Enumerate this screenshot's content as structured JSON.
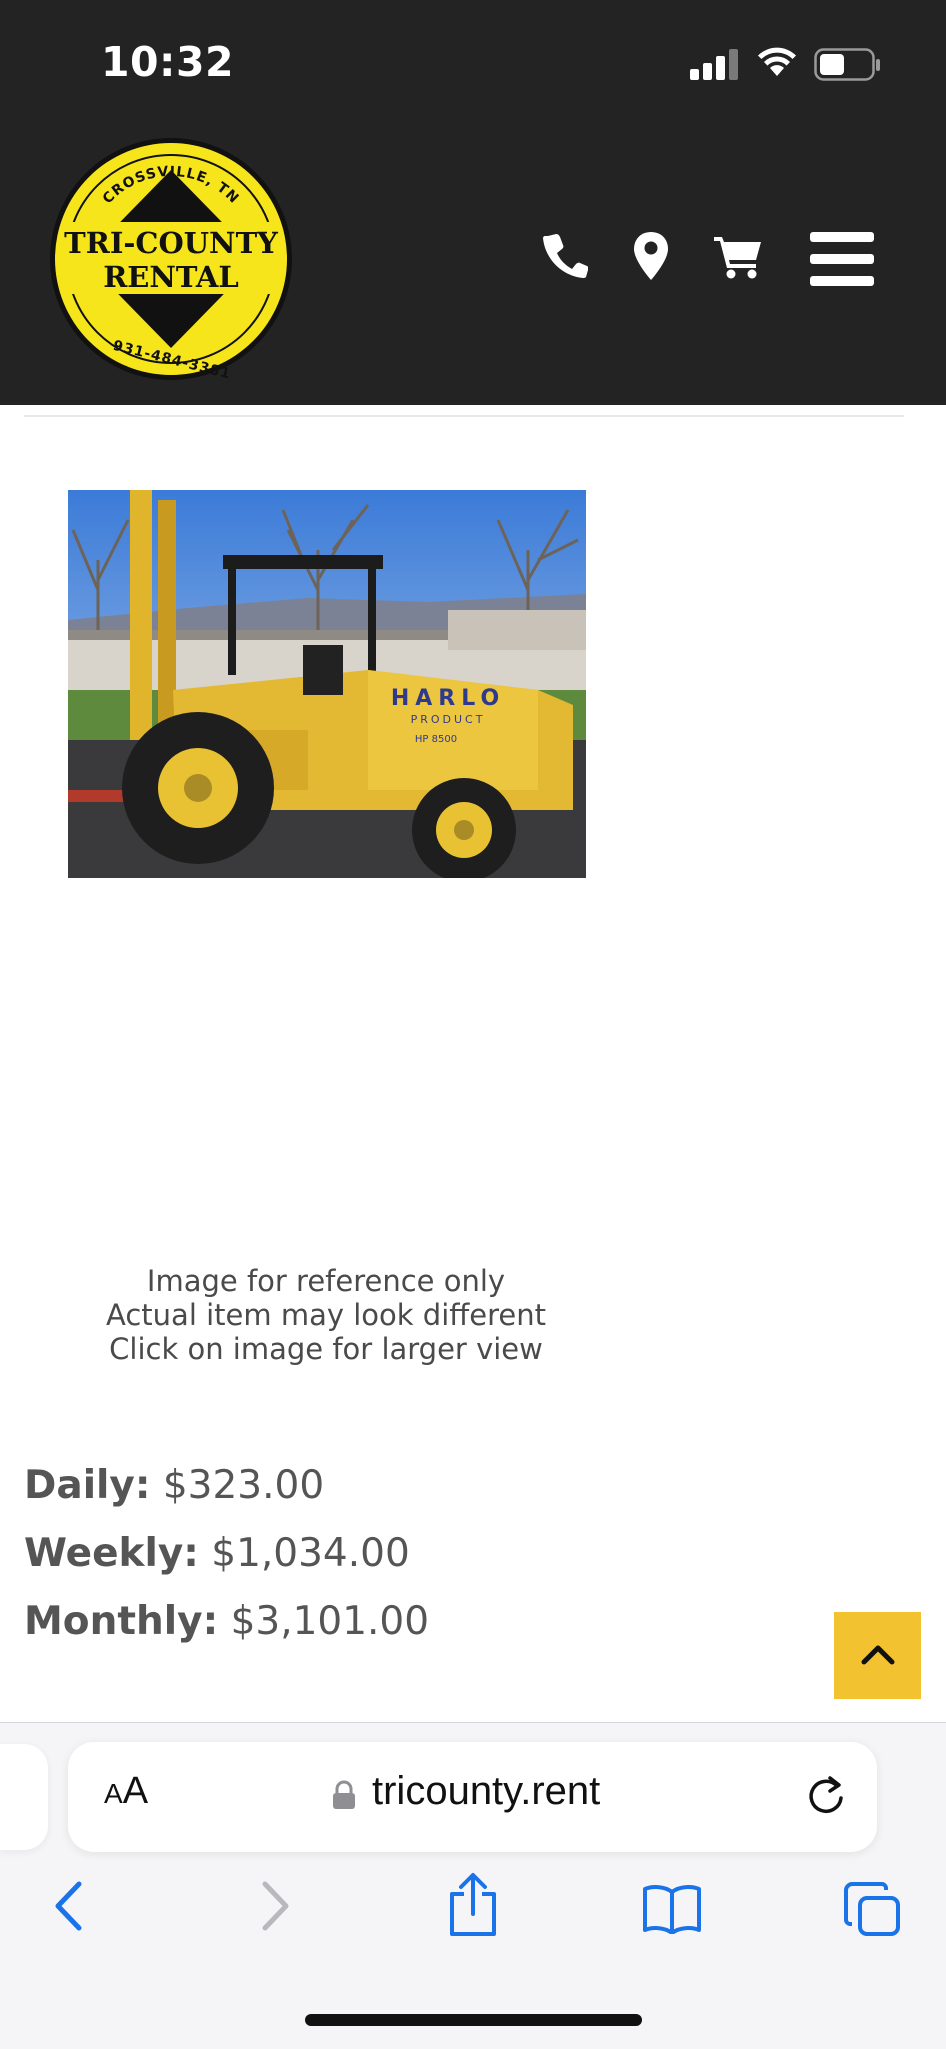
{
  "status_bar": {
    "time": "10:32"
  },
  "header": {
    "logo": {
      "top_text": "CROSSVILLE, TN",
      "line1": "TRI-COUNTY",
      "line2": "RENTAL",
      "bottom_text": "931-484-3381",
      "colors": {
        "yellow": "#f7e51c",
        "black": "#111111"
      }
    },
    "nav_icons": [
      "phone-icon",
      "location-pin-icon",
      "cart-icon",
      "hamburger-menu-icon"
    ]
  },
  "product": {
    "photo_text": {
      "brand": "HARLO",
      "line2": "PRODUCT",
      "model": "HP 8500"
    },
    "caption": [
      "Image for reference only",
      "Actual item may look different",
      "Click on image for larger view"
    ],
    "prices": [
      {
        "label": "Daily:",
        "value": "$323.00"
      },
      {
        "label": "Weekly:",
        "value": "$1,034.00"
      },
      {
        "label": "Monthly:",
        "value": "$3,101.00"
      }
    ]
  },
  "back_to_top": {
    "icon": "chevron-up-icon",
    "color": "#f2c230"
  },
  "browser": {
    "aa_label_small": "A",
    "aa_label_large": "A",
    "url": "tricounty.rent",
    "accent": "#1a73e8"
  }
}
